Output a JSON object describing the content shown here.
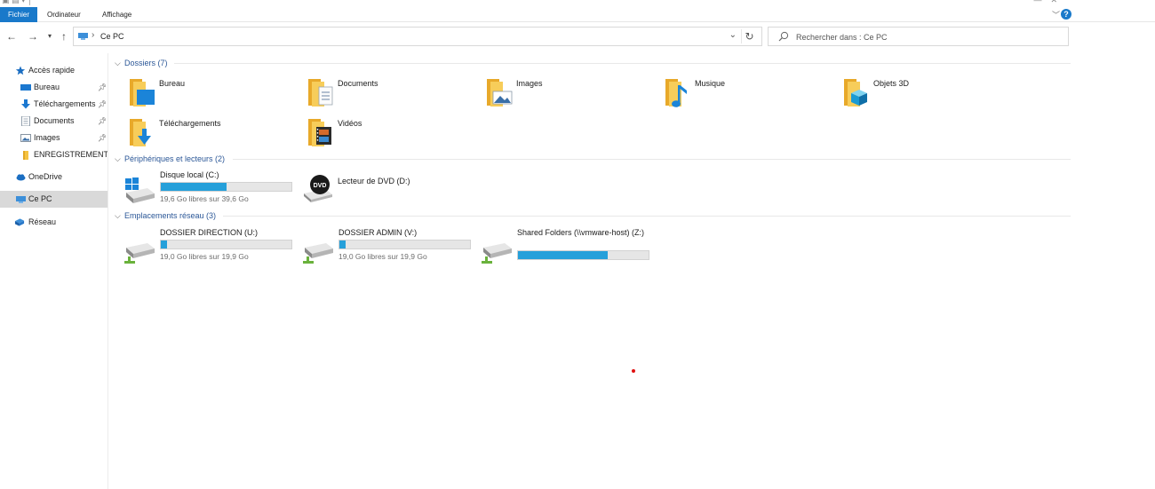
{
  "window": {
    "title": "Ce PC"
  },
  "ribbon": {
    "tabs": [
      "Fichier",
      "Ordinateur",
      "Affichage"
    ]
  },
  "address": {
    "location": "Ce PC"
  },
  "search": {
    "placeholder": "Rechercher dans : Ce PC"
  },
  "sidebar": {
    "items": [
      {
        "label": "Accès rapide",
        "icon": "star-icon",
        "pinned": false
      },
      {
        "label": "Bureau",
        "icon": "desktop-icon",
        "pinned": true
      },
      {
        "label": "Téléchargements",
        "icon": "download-icon",
        "pinned": true
      },
      {
        "label": "Documents",
        "icon": "documents-icon",
        "pinned": true
      },
      {
        "label": "Images",
        "icon": "images-icon",
        "pinned": true
      },
      {
        "label": "ENREGISTREMENT C",
        "icon": "folder-icon",
        "pinned": false
      },
      {
        "label": "OneDrive",
        "icon": "cloud-icon",
        "pinned": false
      },
      {
        "label": "Ce PC",
        "icon": "computer-icon",
        "pinned": false,
        "selected": true
      },
      {
        "label": "Réseau",
        "icon": "network-icon",
        "pinned": false
      }
    ]
  },
  "groups": {
    "folders": {
      "title": "Dossiers (7)",
      "items": [
        {
          "name": "Bureau",
          "icon": "desktop-folder-icon"
        },
        {
          "name": "Documents",
          "icon": "documents-folder-icon"
        },
        {
          "name": "Images",
          "icon": "images-folder-icon"
        },
        {
          "name": "Musique",
          "icon": "music-folder-icon"
        },
        {
          "name": "Objets 3D",
          "icon": "objects3d-folder-icon"
        },
        {
          "name": "Téléchargements",
          "icon": "downloads-folder-icon"
        },
        {
          "name": "Vidéos",
          "icon": "videos-folder-icon"
        }
      ]
    },
    "devices": {
      "title": "Périphériques et lecteurs (2)",
      "items": [
        {
          "name": "Disque local (C:)",
          "free": "19,6 Go libres sur 39,6 Go",
          "used_fraction": 0.505,
          "icon": "local-disk-icon"
        },
        {
          "name": "Lecteur de DVD (D:)",
          "icon": "dvd-drive-icon"
        }
      ]
    },
    "network": {
      "title": "Emplacements réseau (3)",
      "items": [
        {
          "name": "DOSSIER DIRECTION (U:)",
          "free": "19,0 Go libres sur 19,9 Go",
          "used_fraction": 0.045,
          "icon": "network-drive-icon"
        },
        {
          "name": "DOSSIER ADMIN (V:)",
          "free": "19,0 Go libres sur 19,9 Go",
          "used_fraction": 0.045,
          "icon": "network-drive-icon"
        },
        {
          "name": "Shared Folders (\\\\vmware-host) (Z:)",
          "used_fraction": 0.69,
          "icon": "network-drive-icon"
        }
      ]
    }
  },
  "colors": {
    "accent": "#1979ca",
    "bar_fill": "#26a0da",
    "group_header": "#2b5797",
    "folder": "#f5c342"
  }
}
